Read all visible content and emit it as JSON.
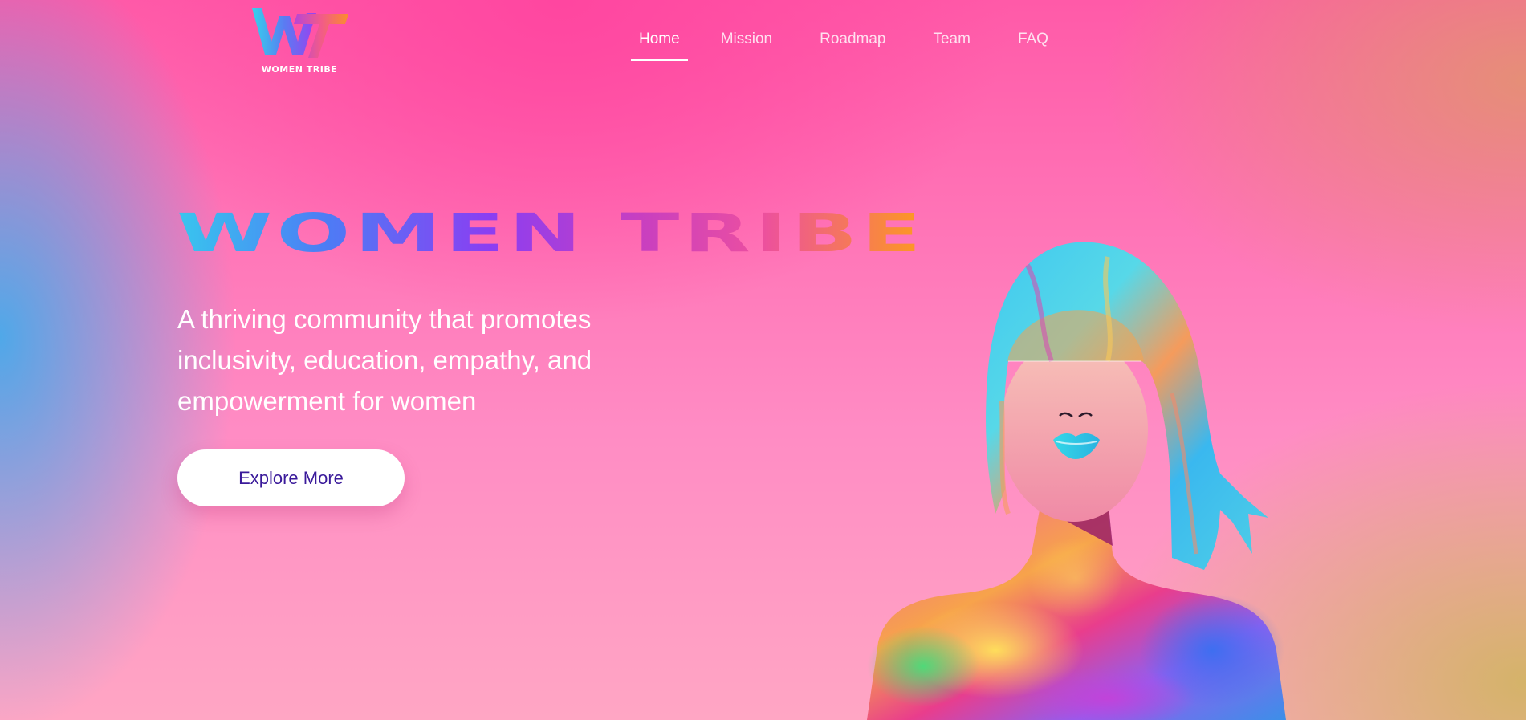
{
  "header": {
    "logo_monogram": "WT",
    "logo_text": "WOMEN TRIBE"
  },
  "nav": {
    "items": [
      {
        "label": "Home",
        "active": true
      },
      {
        "label": "Mission",
        "active": false
      },
      {
        "label": "Roadmap",
        "active": false
      },
      {
        "label": "Team",
        "active": false
      },
      {
        "label": "FAQ",
        "active": false
      }
    ]
  },
  "hero": {
    "title": "WOMEN TRIBE",
    "tagline": "A thriving community that promotes inclusivity, education, empathy, and empowerment for women",
    "cta_label": "Explore More"
  },
  "illustration": {
    "icon": "colorful-woman-portrait-illustration"
  },
  "colors": {
    "background_pink": "#ff5aa8",
    "background_blue_edge": "#46aaeb",
    "background_gold_edge": "#d2b464",
    "title_gradient_start": "#38c6ee",
    "title_gradient_mid": "#8b3ef2",
    "title_gradient_end": "#fd9b1e",
    "cta_text": "#3a1a9a"
  }
}
